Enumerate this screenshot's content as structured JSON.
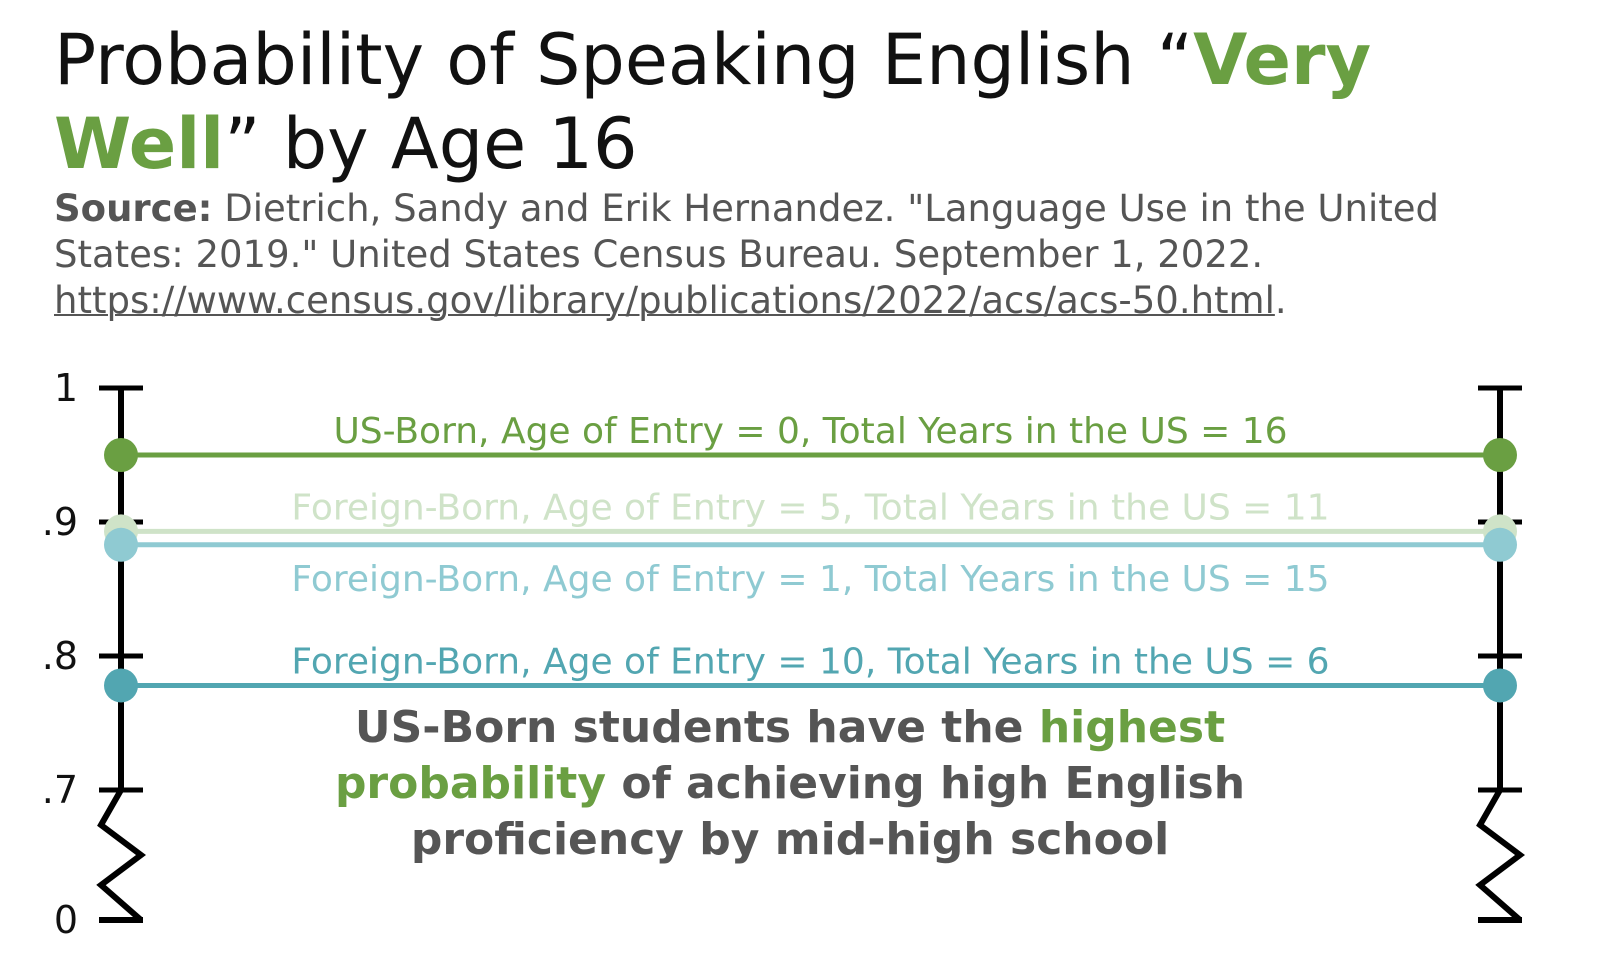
{
  "title": {
    "prefix": "Probability of Speaking English “",
    "accent": "Very Well",
    "suffix": "” by Age 16"
  },
  "source": {
    "label": "Source:",
    "text": " Dietrich, Sandy and Erik Hernandez. \"Language Use in the United States: 2019.\" United States Census Bureau. September 1, 2022. ",
    "link": "https://www.census.gov/library/publications/2022/acs/acs-50.html",
    "end": "."
  },
  "colors": {
    "accent": "#6a9f42",
    "text_gray": "#555555"
  },
  "insight": {
    "part1": "US-Born students have the ",
    "accent": "highest probability",
    "part2": " of achieving high English proficiency by mid-high school"
  },
  "chart_data": {
    "type": "line",
    "y_ticks": [
      {
        "value": 1.0,
        "label": "1"
      },
      {
        "value": 0.9,
        "label": ".9"
      },
      {
        "value": 0.8,
        "label": ".8"
      },
      {
        "value": 0.7,
        "label": ".7"
      },
      {
        "value": 0.0,
        "label": "0"
      }
    ],
    "axis_break": [
      0.0,
      0.7
    ],
    "ylim": [
      0,
      1
    ],
    "series": [
      {
        "name": "US-Born, Age of Entry = 0, Total Years in the US = 16",
        "value": 0.95,
        "color": "#6a9f42",
        "label_pos": "above"
      },
      {
        "name": "Foreign-Born, Age of Entry = 5, Total Years in the US = 11",
        "value": 0.893,
        "color": "#cfe3c8",
        "label_pos": "above"
      },
      {
        "name": "Foreign-Born, Age of Entry = 1, Total Years in the US = 15",
        "value": 0.883,
        "color": "#8fcad2",
        "label_pos": "below"
      },
      {
        "name": "Foreign-Born, Age of Entry = 10, Total Years in the US = 6",
        "value": 0.778,
        "color": "#52a6b1",
        "label_pos": "above"
      }
    ]
  }
}
